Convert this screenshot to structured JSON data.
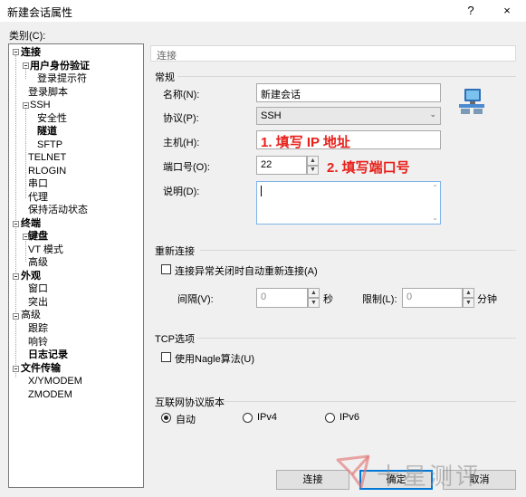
{
  "window": {
    "title": "新建会话属性",
    "help_btn": "?",
    "close_btn": "×"
  },
  "category_label": "类别(C):",
  "tree": {
    "connection": "连接",
    "user_auth": "用户身份验证",
    "login_prompt": "登录提示符",
    "login_script": "登录脚本",
    "ssh": "SSH",
    "security": "安全性",
    "tunnel": "隧道",
    "sftp": "SFTP",
    "telnet": "TELNET",
    "rlogin": "RLOGIN",
    "serial": "串口",
    "proxy": "代理",
    "keepalive": "保持活动状态",
    "terminal": "终端",
    "keyboard": "键盘",
    "vt_mode": "VT 模式",
    "term_advanced": "高级",
    "appearance": "外观",
    "window": "窗口",
    "highlight": "突出",
    "advanced": "高级",
    "trace": "跟踪",
    "bell": "响铃",
    "logging": "日志记录",
    "file_transfer": "文件传输",
    "xymodem": "X/YMODEM",
    "zmodem": "ZMODEM"
  },
  "header": "连接",
  "general": {
    "title": "常规",
    "name_label": "名称(N):",
    "name_value": "新建会话",
    "protocol_label": "协议(P):",
    "protocol_value": "SSH",
    "host_label": "主机(H):",
    "host_value": "",
    "port_label": "端口号(O):",
    "port_value": "22",
    "desc_label": "说明(D):",
    "desc_value": ""
  },
  "annotations": {
    "host": "1. 填写 IP 地址",
    "port": "2. 填写端口号"
  },
  "reconnect": {
    "title": "重新连接",
    "checkbox_label": "连接异常关闭时自动重新连接(A)",
    "interval_label": "间隔(V):",
    "interval_value": "0",
    "interval_unit": "秒",
    "limit_label": "限制(L):",
    "limit_value": "0",
    "limit_unit": "分钟"
  },
  "tcp": {
    "title": "TCP选项",
    "nagle_label": "使用Nagle算法(U)"
  },
  "ipver": {
    "title": "互联网协议版本",
    "auto": "自动",
    "ipv4": "IPv4",
    "ipv6": "IPv6"
  },
  "buttons": {
    "connect": "连接",
    "ok": "确定",
    "cancel": "取消"
  },
  "watermark": "十星测评"
}
